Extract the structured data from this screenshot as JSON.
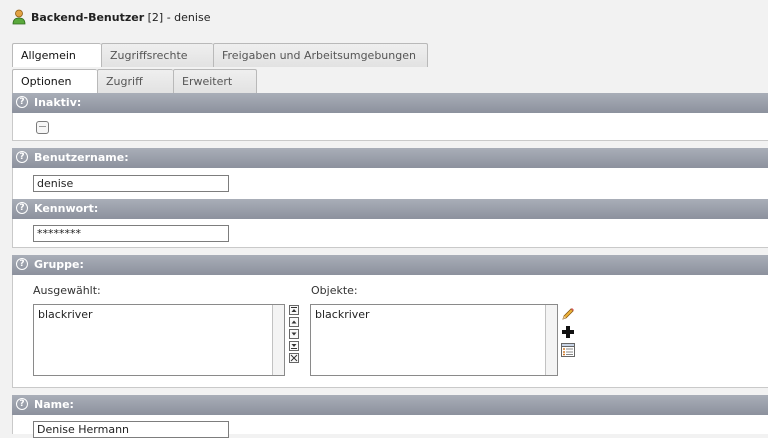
{
  "header": {
    "title_bold": "Backend-Benutzer",
    "title_rest": " [2] - denise"
  },
  "tabs_row1": [
    {
      "label": "Allgemein",
      "active": true
    },
    {
      "label": "Zugriffsrechte",
      "active": false
    },
    {
      "label": "Freigaben und Arbeitsumgebungen",
      "active": false
    }
  ],
  "tabs_row2": [
    {
      "label": "Optionen"
    },
    {
      "label": "Zugriff"
    },
    {
      "label": "Erweitert"
    }
  ],
  "sections": {
    "inaktiv": "Inaktiv:",
    "benutzername": "Benutzername:",
    "kennwort": "Kennwort:",
    "gruppe": "Gruppe:",
    "name": "Name:"
  },
  "fields": {
    "benutzername_value": "denise",
    "kennwort_value": "********",
    "name_value": "Denise Hermann",
    "inaktiv_checked": false
  },
  "gruppe": {
    "selected_label": "Ausgewählt:",
    "objects_label": "Objekte:",
    "selected_items": [
      "blackriver"
    ],
    "object_items": [
      "blackriver"
    ]
  },
  "icons": {
    "user": "user-icon",
    "help": "help-icon",
    "edit": "pencil-icon",
    "add": "plus-icon",
    "list": "list-icon"
  },
  "colors": {
    "section_header": "#9399a5",
    "panel_bg": "#ffffff",
    "page_bg": "#f2f2f2"
  }
}
